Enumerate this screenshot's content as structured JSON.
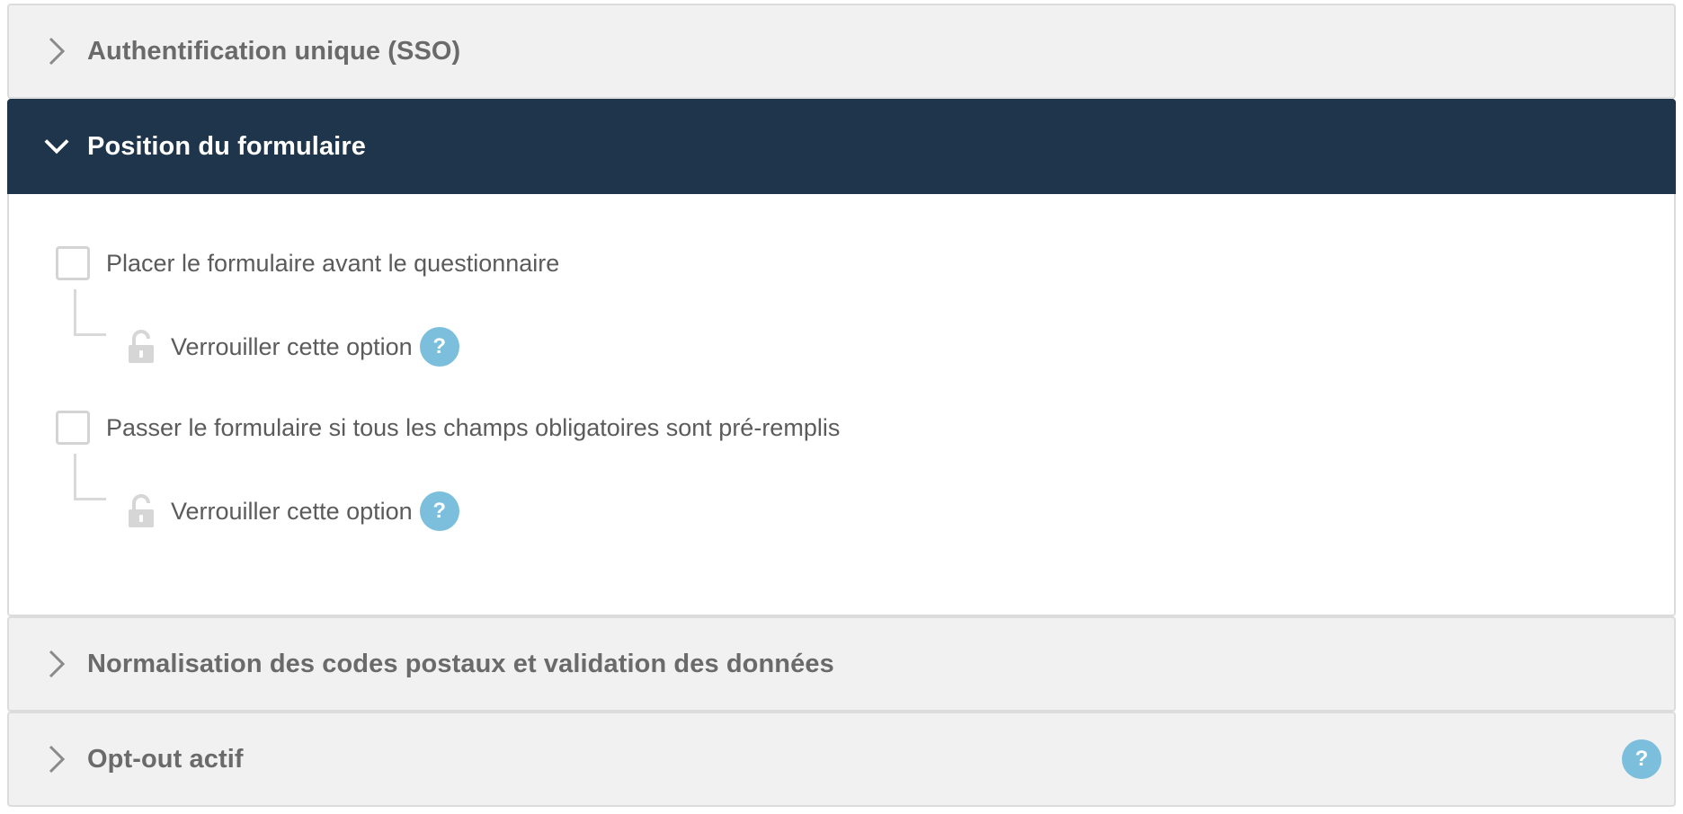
{
  "sections": [
    {
      "title": "Authentification unique (SSO)",
      "expanded": false
    },
    {
      "title": "Position du formulaire",
      "expanded": true
    },
    {
      "title": "Normalisation des codes postaux et validation des données",
      "expanded": false
    },
    {
      "title": "Opt-out actif",
      "expanded": false,
      "has_help": true
    }
  ],
  "form_position": {
    "options": [
      {
        "label": "Placer le formulaire avant le questionnaire",
        "checked": false,
        "lock_label": "Verrouiller cette option",
        "locked": false
      },
      {
        "label": "Passer le formulaire si tous les champs obligatoires sont pré-remplis",
        "checked": false,
        "lock_label": "Verrouiller cette option",
        "locked": false
      }
    ]
  },
  "help_symbol": "?",
  "colors": {
    "active_header": "#1f354b",
    "collapsed_header": "#f1f1f1",
    "help_badge": "#7bbfdc",
    "border": "#dcdcdc"
  },
  "icons": {
    "collapsed": "chevron-right-icon",
    "expanded": "chevron-down-icon",
    "lock": "lock-open-icon",
    "help": "question-icon"
  }
}
